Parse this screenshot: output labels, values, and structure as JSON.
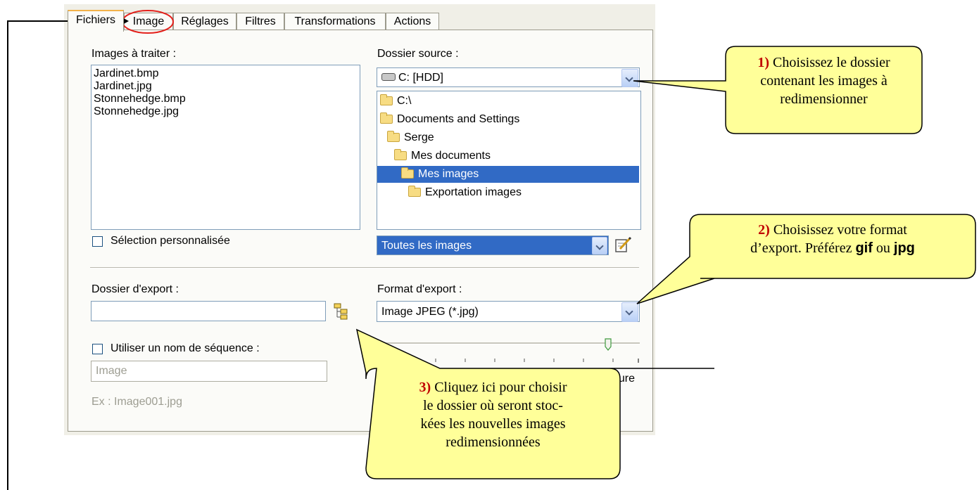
{
  "tabs": [
    "Fichiers",
    "Image",
    "Réglages",
    "Filtres",
    "Transformations",
    "Actions"
  ],
  "images_panel": {
    "label": "Images à traiter :",
    "files": [
      "Jardinet.bmp",
      "Jardinet.jpg",
      "Stonnehedge.bmp",
      "Stonnehedge.jpg"
    ],
    "custom_selection_label": "Sélection personnalisée"
  },
  "source_panel": {
    "label": "Dossier source :",
    "drive": "C: [HDD]",
    "tree": [
      "C:\\",
      "Documents and Settings",
      "Serge",
      "Mes documents",
      "Mes images",
      "Exportation images"
    ],
    "selected": "Mes images",
    "filter": "Toutes les images"
  },
  "export_panel": {
    "folder_label": "Dossier d'export :",
    "folder_value": "",
    "sequence_label": "Utiliser un nom de séquence :",
    "sequence_placeholder": "Image",
    "example": "Ex : Image001.jpg"
  },
  "format_panel": {
    "label": "Format d'export :",
    "value": "Image JPEG (*.jpg)",
    "quality_slider_value": 0.88,
    "quality_label_partial": "eure"
  },
  "callouts": {
    "c1": {
      "num": "1)",
      "line1": "Choisissez le dossier",
      "line2": "contenant les images à",
      "line3": "redimensionner"
    },
    "c2": {
      "num": "2)",
      "line1": "Choisissez votre format",
      "line2a": "d’export. Préférez",
      "fmt1": "gif",
      "or": "ou",
      "fmt2": "jpg"
    },
    "c3": {
      "num": "3)",
      "line1": "Cliquez ici pour choisir",
      "line2": "le dossier où seront stoc-",
      "line3": "kées les nouvelles images",
      "line4": "redimensionnées"
    }
  },
  "colors": {
    "accent_selection": "#316ac5",
    "callout_fill": "#ffff99",
    "number_red": "#c00000",
    "tab_highlight": "#f3b24a"
  }
}
